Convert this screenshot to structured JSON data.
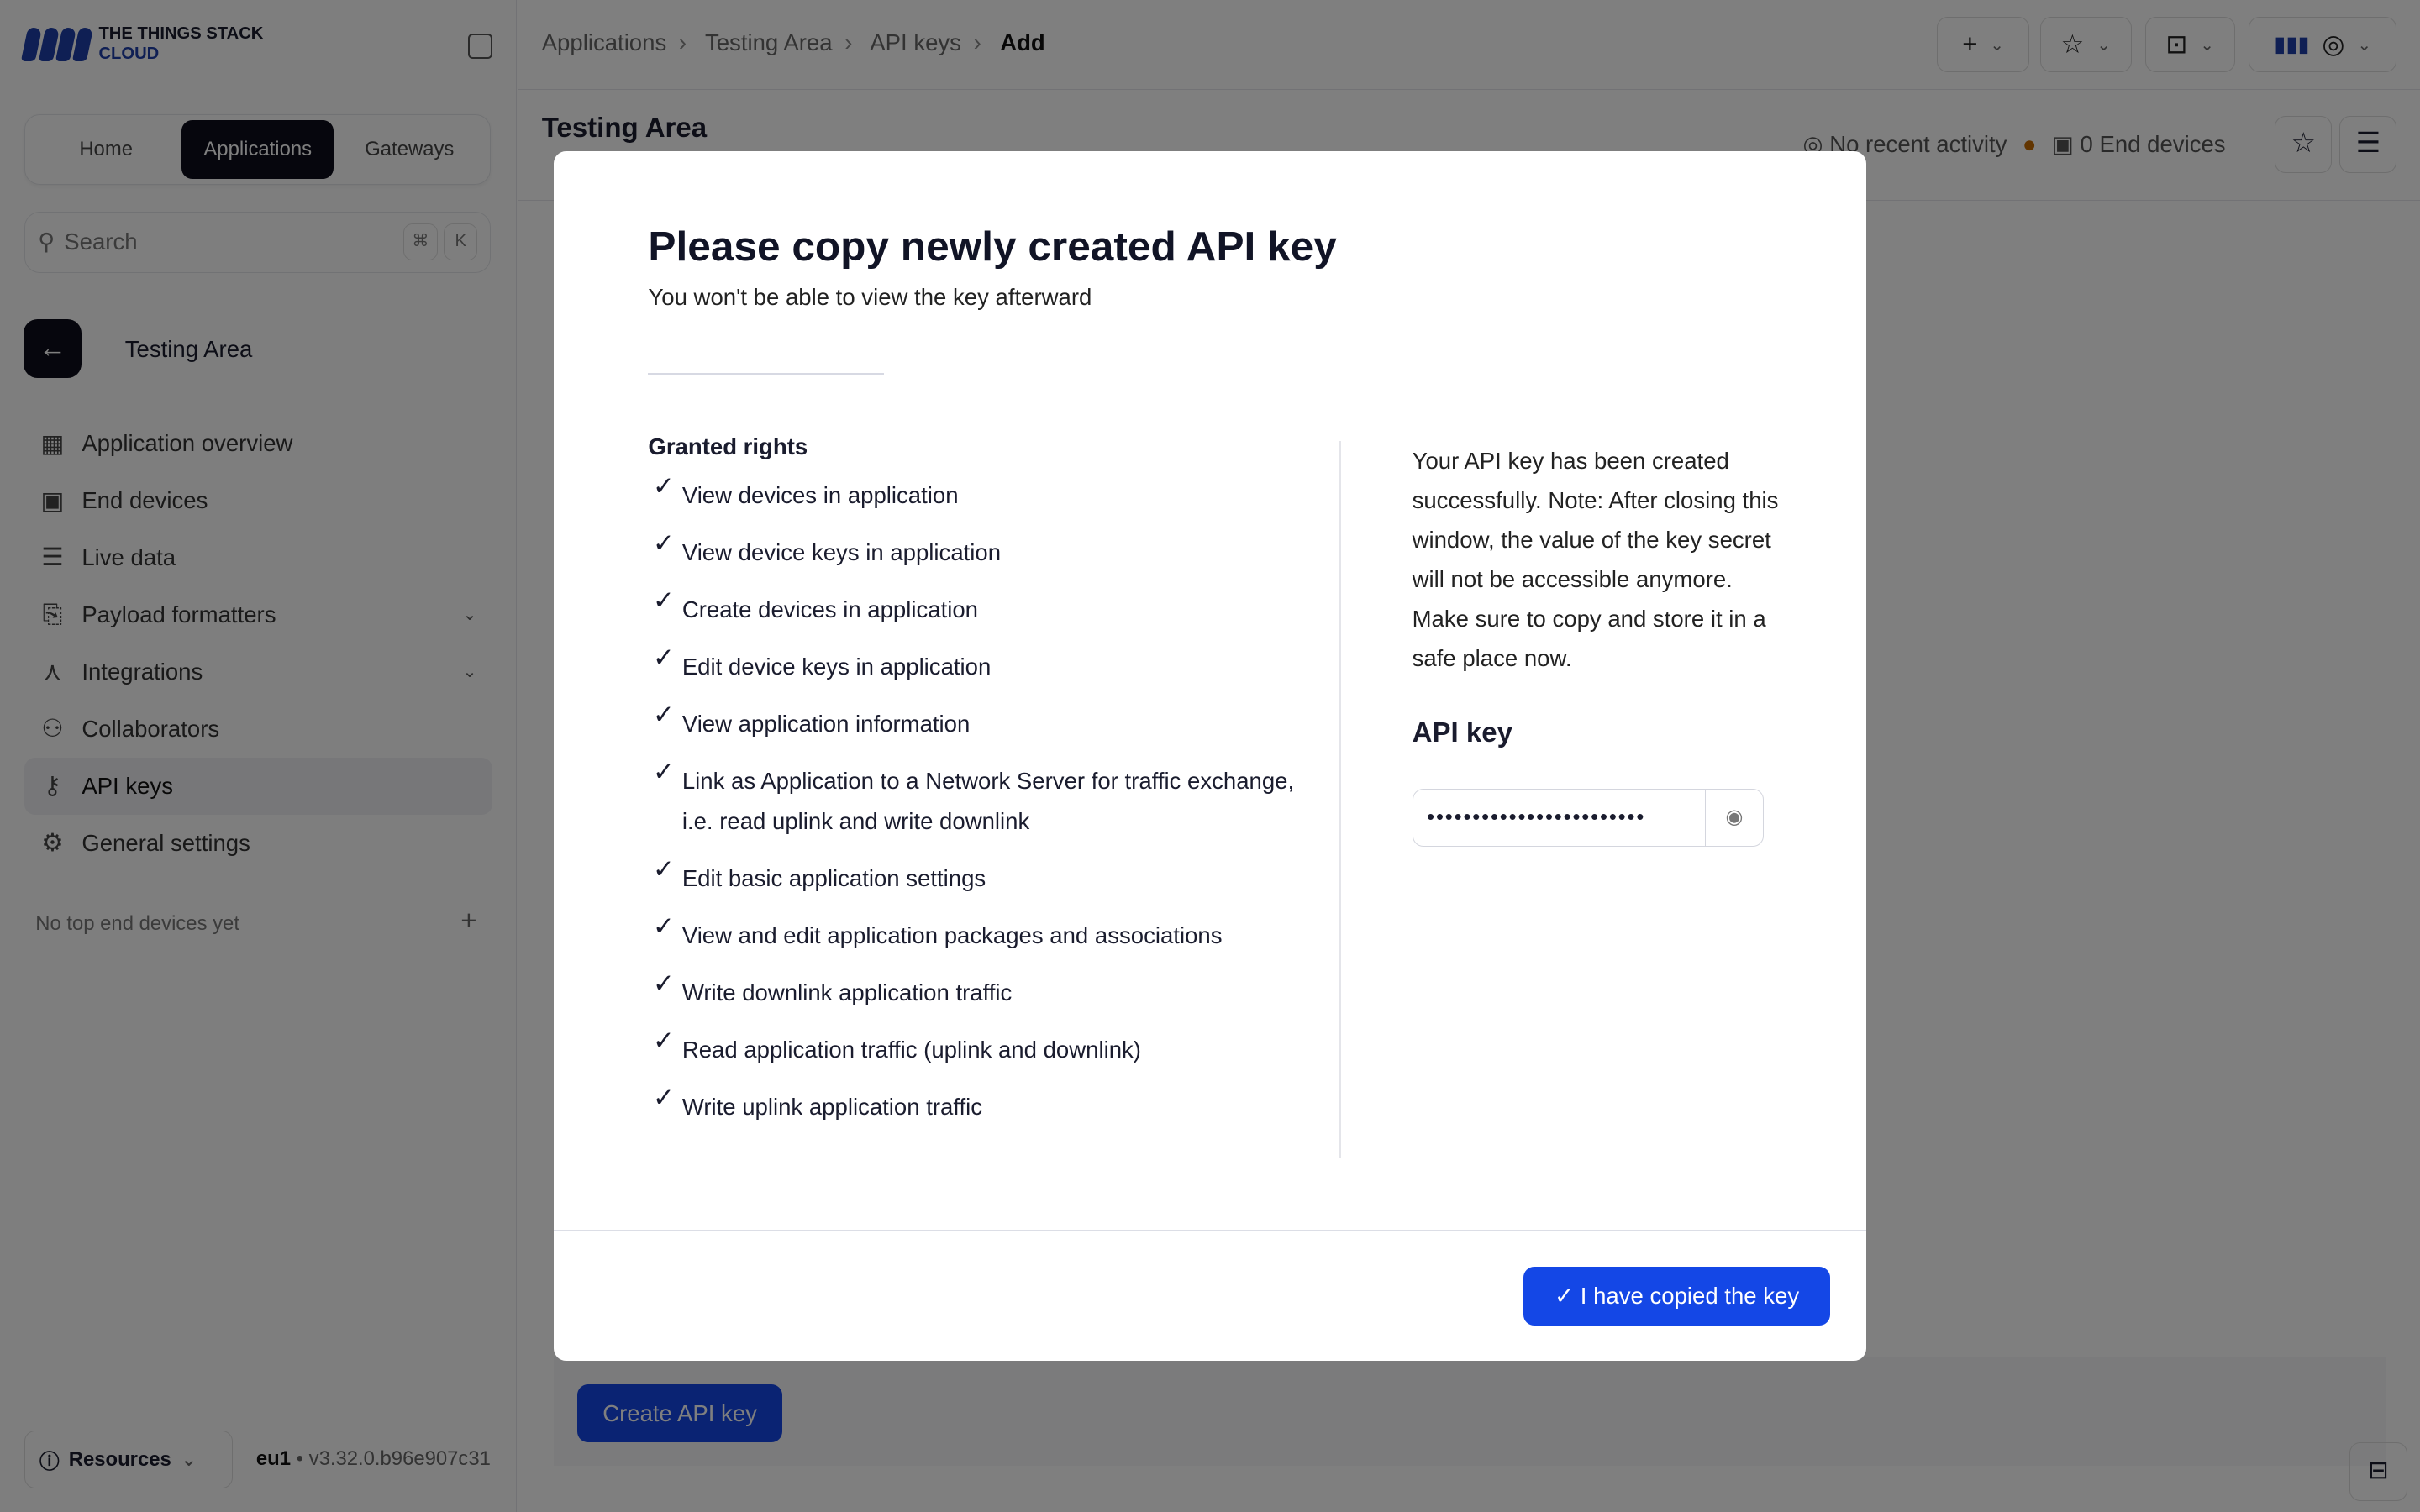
{
  "brand": {
    "line1": "THE THINGS STACK",
    "line2": "CLOUD",
    "accent": "#1e3fa8"
  },
  "sidebar": {
    "switcher": [
      "Home",
      "Applications",
      "Gateways"
    ],
    "search_placeholder": "Search",
    "kbd": [
      "⌘",
      "K"
    ],
    "app_name": "Testing Area",
    "items": [
      {
        "label": "Application overview",
        "icon": "grid-icon"
      },
      {
        "label": "End devices",
        "icon": "chip-icon"
      },
      {
        "label": "Live data",
        "icon": "list-icon"
      },
      {
        "label": "Payload formatters",
        "icon": "code-icon"
      },
      {
        "label": "Integrations",
        "icon": "integration-icon"
      },
      {
        "label": "Collaborators",
        "icon": "users-icon"
      },
      {
        "label": "API keys",
        "icon": "key-icon"
      },
      {
        "label": "General settings",
        "icon": "gear-icon"
      }
    ],
    "no_top": "No top end devices yet",
    "resources": "Resources",
    "cluster": "eu1",
    "version": "v3.32.0.b96e907c31"
  },
  "breadcrumbs": [
    "Applications",
    "Testing Area",
    "API keys",
    "Add"
  ],
  "header": {
    "title": "Testing Area",
    "activity": "No recent activity",
    "devices": "0 End devices"
  },
  "create_button": "Create API key",
  "modal": {
    "title": "Please copy newly created API key",
    "subtitle": "You won't be able to view the key afterward",
    "rights_heading": "Granted rights",
    "rights": [
      "View devices in application",
      "View device keys in application",
      "Create devices in application",
      "Edit device keys in application",
      "View application information",
      "Link as Application to a Network Server for traffic exchange, i.e. read uplink and write downlink",
      "Edit basic application settings",
      "View and edit application packages and associations",
      "Write downlink application traffic",
      "Read application traffic (uplink and downlink)",
      "Write uplink application traffic"
    ],
    "info": "Your API key has been created successfully. Note: After closing this window, the value of the key secret will not be accessible anymore. Make sure to copy and store it in a safe place now.",
    "api_key_label": "API key",
    "api_key_masked": "••••••••••••••••••••••••",
    "confirm": "I have copied the key",
    "primary_color": "#1447e6"
  }
}
